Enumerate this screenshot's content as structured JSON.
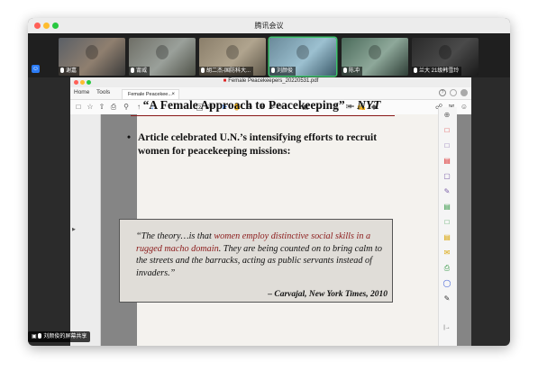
{
  "window": {
    "title": "腾讯会议"
  },
  "participants": [
    {
      "name": "谢嘉",
      "colors": [
        "#5a5f66",
        "#8f7f6f",
        "#3b3b3b"
      ]
    },
    {
      "name": "甯威",
      "colors": [
        "#6e6e66",
        "#9aa09a",
        "#4f5248"
      ]
    },
    {
      "name": "胡二杰-国防科大...",
      "colors": [
        "#8a7e6a",
        "#b0a48e",
        "#5e5648"
      ]
    },
    {
      "name": "刘颜俊",
      "colors": [
        "#6a8a9a",
        "#9cc0d0",
        "#3b5a6a"
      ],
      "selected": true
    },
    {
      "name": "陈冲",
      "colors": [
        "#4a6a5a",
        "#8ea89a",
        "#2e3e36"
      ]
    },
    {
      "name": "兰大 21级韩雪玲",
      "colors": [
        "#2a2a2a",
        "#4a4a4a",
        "#1a1a1a"
      ]
    }
  ],
  "pdf": {
    "filename": "Female Peacekeepers_20220531.pdf",
    "menu": {
      "home": "Home",
      "tools": "Tools"
    },
    "tab_label": "Female Peacekee...",
    "tab_close": "×",
    "current_page": "2",
    "total_pages": "/ 29",
    "zoom": "92.2%",
    "tooltip": "Show next page (→)"
  },
  "slide": {
    "title": "“A Female Approach to Peacekeeping” – ",
    "title_source": "NYT",
    "bullet": "Article celebrated U.N.’s intensifying efforts to recruit women for peacekeeping missions:",
    "quote_pre": "“The theory…is that ",
    "quote_highlight": "women employ distinctive social skills in a rugged macho domain",
    "quote_post": ". They are being counted on to bring calm to the streets and the barracks, acting as public servants instead of invaders.”",
    "attribution": "– Carvajal, New York Times, 2010",
    "accent": "#8b1a1a"
  },
  "screen_share_label": "刘颜俊的屏幕共享"
}
